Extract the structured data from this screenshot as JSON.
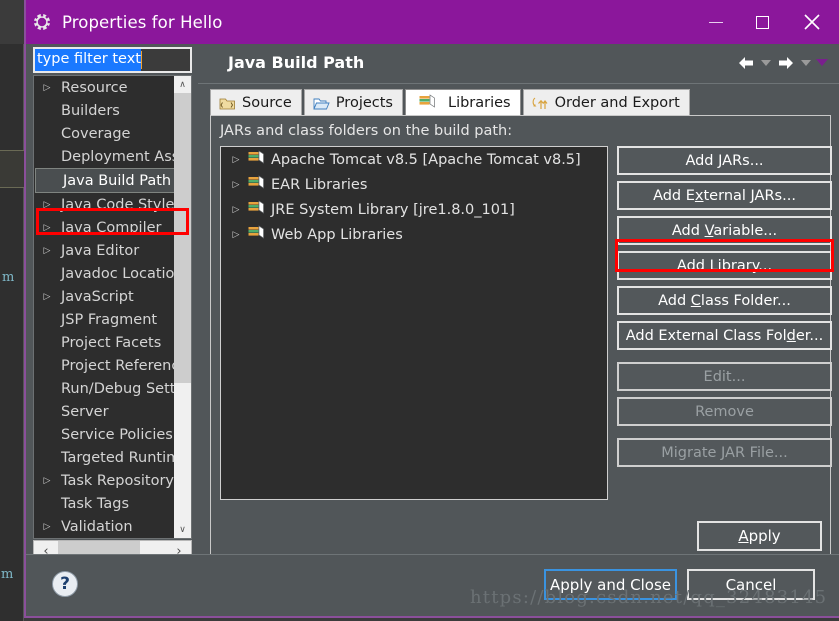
{
  "window": {
    "title": "Properties for Hello",
    "icon": "gear-icon",
    "minimize_label": "Minimize",
    "maximize_label": "Maximize",
    "close_label": "Close",
    "titlebar_color": "#8b179b"
  },
  "sidebar": {
    "filter": {
      "value": "type filter text",
      "placeholder": "type filter text",
      "selected": true
    },
    "items": [
      {
        "label": "Resource",
        "expandable": true,
        "selected": false
      },
      {
        "label": "Builders",
        "expandable": false,
        "selected": false
      },
      {
        "label": "Coverage",
        "expandable": false,
        "selected": false
      },
      {
        "label": "Deployment Assembly",
        "expandable": false,
        "selected": false
      },
      {
        "label": "Java Build Path",
        "expandable": false,
        "selected": true
      },
      {
        "label": "Java Code Style",
        "expandable": true,
        "selected": false
      },
      {
        "label": "Java Compiler",
        "expandable": true,
        "selected": false
      },
      {
        "label": "Java Editor",
        "expandable": true,
        "selected": false
      },
      {
        "label": "Javadoc Location",
        "expandable": false,
        "selected": false
      },
      {
        "label": "JavaScript",
        "expandable": true,
        "selected": false
      },
      {
        "label": "JSP Fragment",
        "expandable": false,
        "selected": false
      },
      {
        "label": "Project Facets",
        "expandable": false,
        "selected": false
      },
      {
        "label": "Project References",
        "expandable": false,
        "selected": false
      },
      {
        "label": "Run/Debug Settings",
        "expandable": false,
        "selected": false
      },
      {
        "label": "Server",
        "expandable": false,
        "selected": false
      },
      {
        "label": "Service Policies",
        "expandable": false,
        "selected": false
      },
      {
        "label": "Targeted Runtimes",
        "expandable": false,
        "selected": false
      },
      {
        "label": "Task Repository",
        "expandable": true,
        "selected": false
      },
      {
        "label": "Task Tags",
        "expandable": false,
        "selected": false
      },
      {
        "label": "Validation",
        "expandable": true,
        "selected": false
      }
    ],
    "scroll_up": "∧",
    "scroll_down": "∨",
    "scroll_left": "‹",
    "scroll_right": "›"
  },
  "content": {
    "page_title": "Java Build Path",
    "nav": {
      "back": "←",
      "back_menu": "▾",
      "forward": "→",
      "forward_menu": "▾",
      "view_menu": "▾"
    },
    "tabs": [
      {
        "label": "Source",
        "icon": "source-folder-icon",
        "active": false
      },
      {
        "label": "Projects",
        "icon": "open-folder-icon",
        "active": false
      },
      {
        "label": "Libraries",
        "icon": "library-books-icon",
        "active": true
      },
      {
        "label": "Order and Export",
        "icon": "order-export-icon",
        "active": false
      }
    ],
    "jars_label": "JARs and class folders on the build path:",
    "libraries": [
      {
        "label": "Apache Tomcat v8.5 [Apache Tomcat v8.5]",
        "icon": "library-books-icon",
        "expandable": true
      },
      {
        "label": "EAR Libraries",
        "icon": "library-books-icon",
        "expandable": true
      },
      {
        "label": "JRE System Library [jre1.8.0_101]",
        "icon": "library-books-icon",
        "expandable": true
      },
      {
        "label": "Web App Libraries",
        "icon": "library-books-icon",
        "expandable": true
      }
    ],
    "buttons": [
      {
        "pre": "Add ",
        "mnemonic": "J",
        "post": "ARs...",
        "disabled": false,
        "gap": false,
        "name": "add-jars-button"
      },
      {
        "pre": "Add E",
        "mnemonic": "x",
        "post": "ternal JARs...",
        "disabled": false,
        "gap": false,
        "name": "add-external-jars-button"
      },
      {
        "pre": "Add ",
        "mnemonic": "V",
        "post": "ariable...",
        "disabled": false,
        "gap": false,
        "name": "add-variable-button"
      },
      {
        "pre": "Add Li",
        "mnemonic": "b",
        "post": "rary...",
        "disabled": false,
        "gap": false,
        "name": "add-library-button"
      },
      {
        "pre": "Add ",
        "mnemonic": "C",
        "post": "lass Folder...",
        "disabled": false,
        "gap": false,
        "name": "add-class-folder-button"
      },
      {
        "pre": "Add External Class Fol",
        "mnemonic": "d",
        "post": "er...",
        "disabled": false,
        "gap": false,
        "name": "add-external-class-folder-button"
      },
      {
        "pre": "Edit...",
        "mnemonic": "",
        "post": "",
        "disabled": true,
        "gap": true,
        "name": "edit-button"
      },
      {
        "pre": "Remove",
        "mnemonic": "",
        "post": "",
        "disabled": true,
        "gap": false,
        "name": "remove-button"
      },
      {
        "pre": "Migrate JAR File...",
        "mnemonic": "",
        "post": "",
        "disabled": true,
        "gap": true,
        "name": "migrate-jar-file-button"
      }
    ],
    "apply": {
      "pre": "",
      "mnemonic": "A",
      "post": "pply"
    }
  },
  "footer": {
    "help": "?",
    "apply_and_close": "Apply and Close",
    "cancel": "Cancel"
  },
  "annotations": {
    "highlight_color": "#ff0000",
    "boxes": [
      "java-build-path-sidebar-item",
      "add-library-button"
    ]
  },
  "watermark": "https://blog.csdn.net/qq_32483145"
}
